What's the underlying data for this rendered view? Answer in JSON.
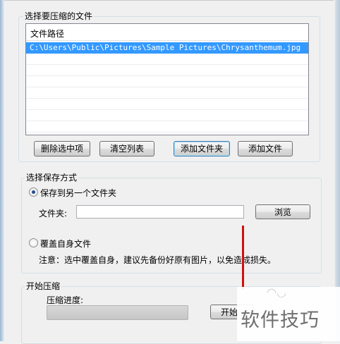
{
  "file_group": {
    "title": "选择要压缩的文件",
    "column_header": "文件路径",
    "rows": [
      {
        "path": "C:\\Users\\Public\\Pictures\\Sample Pictures\\Chrysanthemum.jpg",
        "selected": true
      }
    ],
    "buttons": {
      "delete_selected": "删除选中项",
      "clear_list": "清空列表",
      "add_folder": "添加文件夹",
      "add_file": "添加文件"
    }
  },
  "save_group": {
    "title": "选择保存方式",
    "option_other_folder": "保存到另一个文件夹",
    "option_other_folder_checked": true,
    "folder_label": "文件夹:",
    "folder_value": "",
    "browse_button": "浏览",
    "option_overwrite": "覆盖自身文件",
    "option_overwrite_checked": false,
    "note": "注意：选中覆盖自身，建议先备份好原有图片，以免造成损失。"
  },
  "start_group": {
    "title": "开始压缩",
    "progress_label": "压缩进度:",
    "progress_fraction": 0,
    "start_button": "开始"
  },
  "watermark": {
    "text": "软件技巧"
  },
  "colors": {
    "selection": "#3399ff",
    "annotation_red": "#d01010"
  }
}
